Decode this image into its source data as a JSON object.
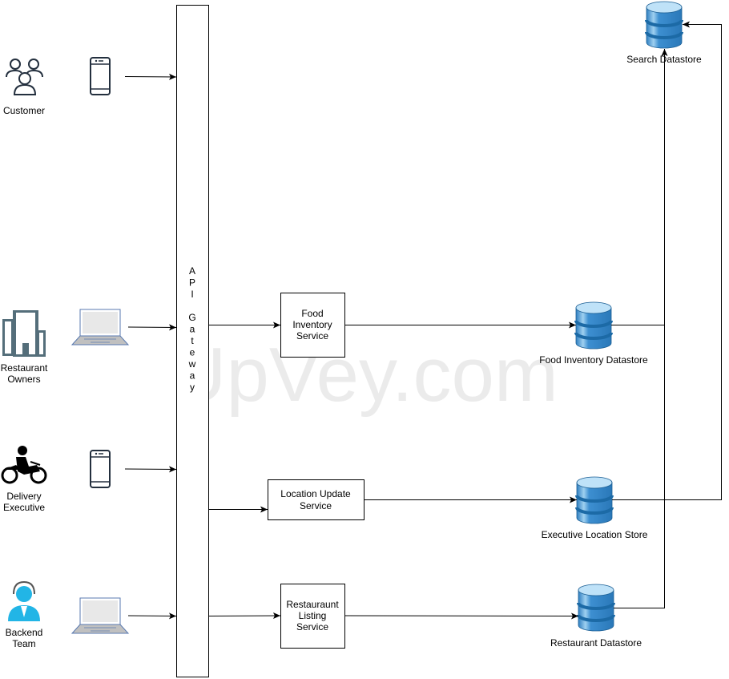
{
  "watermark": "UpVey.com",
  "gateway": {
    "letters": [
      "A",
      "P",
      "I",
      "",
      "G",
      "a",
      "t",
      "e",
      "w",
      "a",
      "y"
    ]
  },
  "actors": [
    {
      "label_lines": [
        "Customer"
      ],
      "icon": "users-icon",
      "device": "mobile-phone-icon"
    },
    {
      "label_lines": [
        "Restaurant",
        "Owners"
      ],
      "icon": "building-icon",
      "device": "laptop-icon"
    },
    {
      "label_lines": [
        "Delivery",
        "Executive"
      ],
      "icon": "motorbike-rider-icon",
      "device": "mobile-phone-icon"
    },
    {
      "label_lines": [
        "Backend",
        "Team"
      ],
      "icon": "support-agent-icon",
      "device": "laptop-icon"
    }
  ],
  "services": [
    {
      "label_lines": [
        "Food",
        "Inventory",
        "Service"
      ]
    },
    {
      "label_lines": [
        "Location Update",
        "Service"
      ]
    },
    {
      "label_lines": [
        "Restauraunt",
        "Listing",
        "Service"
      ]
    }
  ],
  "datastores": [
    {
      "label": "Search Datastore"
    },
    {
      "label": "Food Inventory Datastore"
    },
    {
      "label": "Executive Location Store"
    },
    {
      "label": "Restaurant Datastore"
    }
  ],
  "colors": {
    "db_blue": "#3d8fd1",
    "db_dark": "#1c6aa6",
    "icon_slate": "#546e7a",
    "agent_cyan": "#22b5e6"
  }
}
